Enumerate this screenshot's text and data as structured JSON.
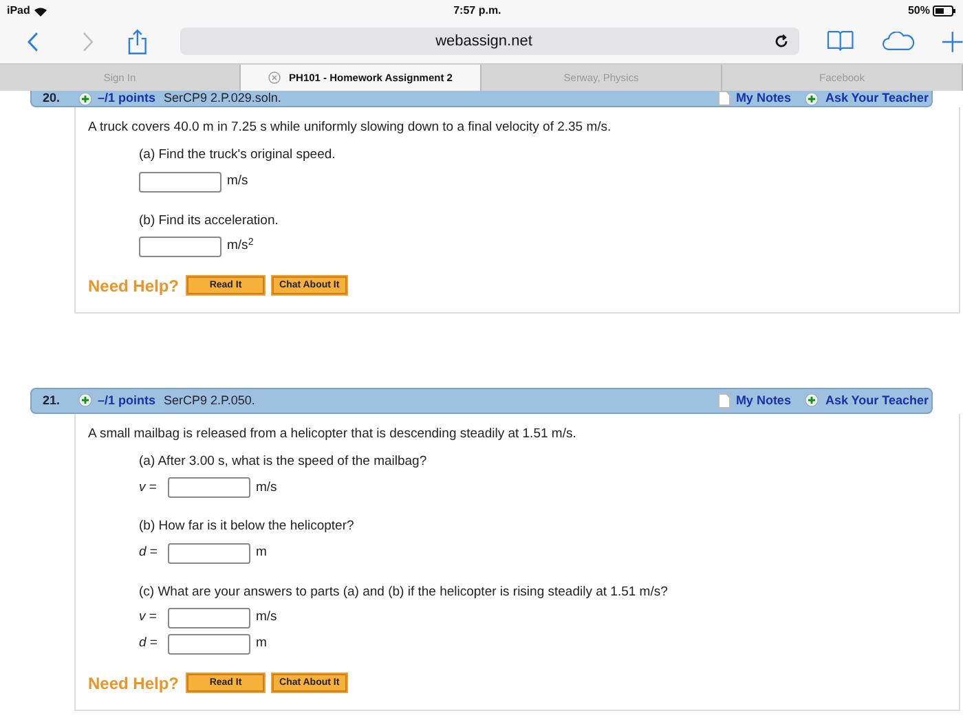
{
  "status_bar": {
    "device": "iPad",
    "time": "7:57 p.m.",
    "battery": "50%"
  },
  "address_bar": {
    "url": "webassign.net"
  },
  "tabs": [
    {
      "label": "Sign In",
      "selected": false,
      "closable": false
    },
    {
      "label": "PH101 - Homework Assignment 2",
      "selected": true,
      "closable": true
    },
    {
      "label": "Serway, Physics",
      "selected": false,
      "closable": false
    },
    {
      "label": "Facebook",
      "selected": false,
      "closable": false
    }
  ],
  "questions": [
    {
      "number": "20.",
      "points": "–/1 points",
      "code": "SerCP9 2.P.029.soln.",
      "my_notes": "My Notes",
      "ask": "Ask Your Teacher",
      "partial": true,
      "text": "A truck covers 40.0 m in 7.25 s while uniformly slowing down to a final velocity of 2.35 m/s.",
      "parts": [
        {
          "prompt": "(a) Find the truck's original speed.",
          "answers": [
            {
              "unit": "m/s"
            }
          ]
        },
        {
          "prompt": "(b) Find its acceleration.",
          "answers": [
            {
              "unit": "m/s$^{2}$"
            }
          ]
        }
      ],
      "help": {
        "label": "Need Help?",
        "buttons": [
          "Read It",
          "Chat About It"
        ]
      }
    },
    {
      "number": "21.",
      "points": "–/1 points",
      "code": "SerCP9 2.P.050.",
      "my_notes": "My Notes",
      "ask": "Ask Your Teacher",
      "partial": false,
      "text": "A small mailbag is released from a helicopter that is descending steadily at 1.51 m/s.",
      "parts": [
        {
          "prompt": "(a) After 3.00 s, what is the speed of the mailbag?",
          "answers": [
            {
              "variable": "*v* =",
              "unit": "m/s"
            }
          ]
        },
        {
          "prompt": "(b) How far is it below the helicopter?",
          "answers": [
            {
              "variable": "*d* =",
              "unit": "m"
            }
          ]
        },
        {
          "prompt": "(c) What are your answers to parts (a) and (b) if the helicopter is rising steadily at 1.51 m/s?",
          "answers": [
            {
              "variable": "*v* =",
              "unit": "m/s"
            },
            {
              "variable": "*d* =",
              "unit": "m"
            }
          ]
        }
      ],
      "help": {
        "label": "Need Help?",
        "buttons": [
          "Read It",
          "Chat About It"
        ]
      }
    }
  ]
}
